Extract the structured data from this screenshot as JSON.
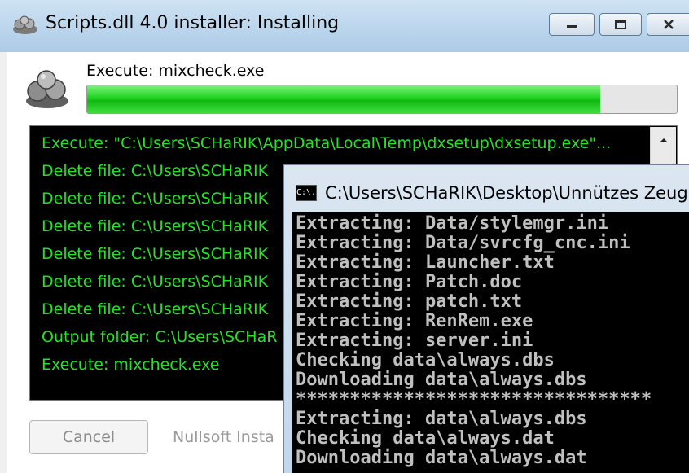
{
  "colors": {
    "log_text": "#26e226",
    "progress_fill": "#1fd21f",
    "console_text": "#c0c0c0"
  },
  "installer": {
    "title": "Scripts.dll 4.0 installer: Installing",
    "status": "Execute: mixcheck.exe",
    "progress_fraction": 0.87,
    "log_lines": [
      "Execute: \"C:\\Users\\SCHaRIK\\AppData\\Local\\Temp\\dxsetup\\dxsetup.exe\"...",
      "Delete file: C:\\Users\\SCHaRIK",
      "Delete file: C:\\Users\\SCHaRIK",
      "Delete file: C:\\Users\\SCHaRIK",
      "Delete file: C:\\Users\\SCHaRIK",
      "Delete file: C:\\Users\\SCHaRIK",
      "Delete file: C:\\Users\\SCHaRIK",
      "Output folder: C:\\Users\\SCHaR",
      "Execute: mixcheck.exe"
    ],
    "cancel_label": "Cancel",
    "branding": "Nullsoft Insta",
    "window_buttons": {
      "minimize_icon": "minimize-icon",
      "maximize_icon": "maximize-icon",
      "close_icon": "close-icon"
    }
  },
  "console": {
    "icon_label": "C:\\.",
    "title": "C:\\Users\\SCHaRIK\\Desktop\\Unnützes Zeug",
    "lines": [
      "Extracting: Data/stylemgr.ini",
      "Extracting: Data/svrcfg_cnc.ini",
      "Extracting: Launcher.txt",
      "Extracting: Patch.doc",
      "Extracting: patch.txt",
      "Extracting: RenRem.exe",
      "Extracting: server.ini",
      "Checking data\\always.dbs",
      "Downloading data\\always.dbs",
      "*********************************",
      "Extracting: data\\always.dbs",
      "Checking data\\always.dat",
      "Downloading data\\always.dat"
    ]
  }
}
